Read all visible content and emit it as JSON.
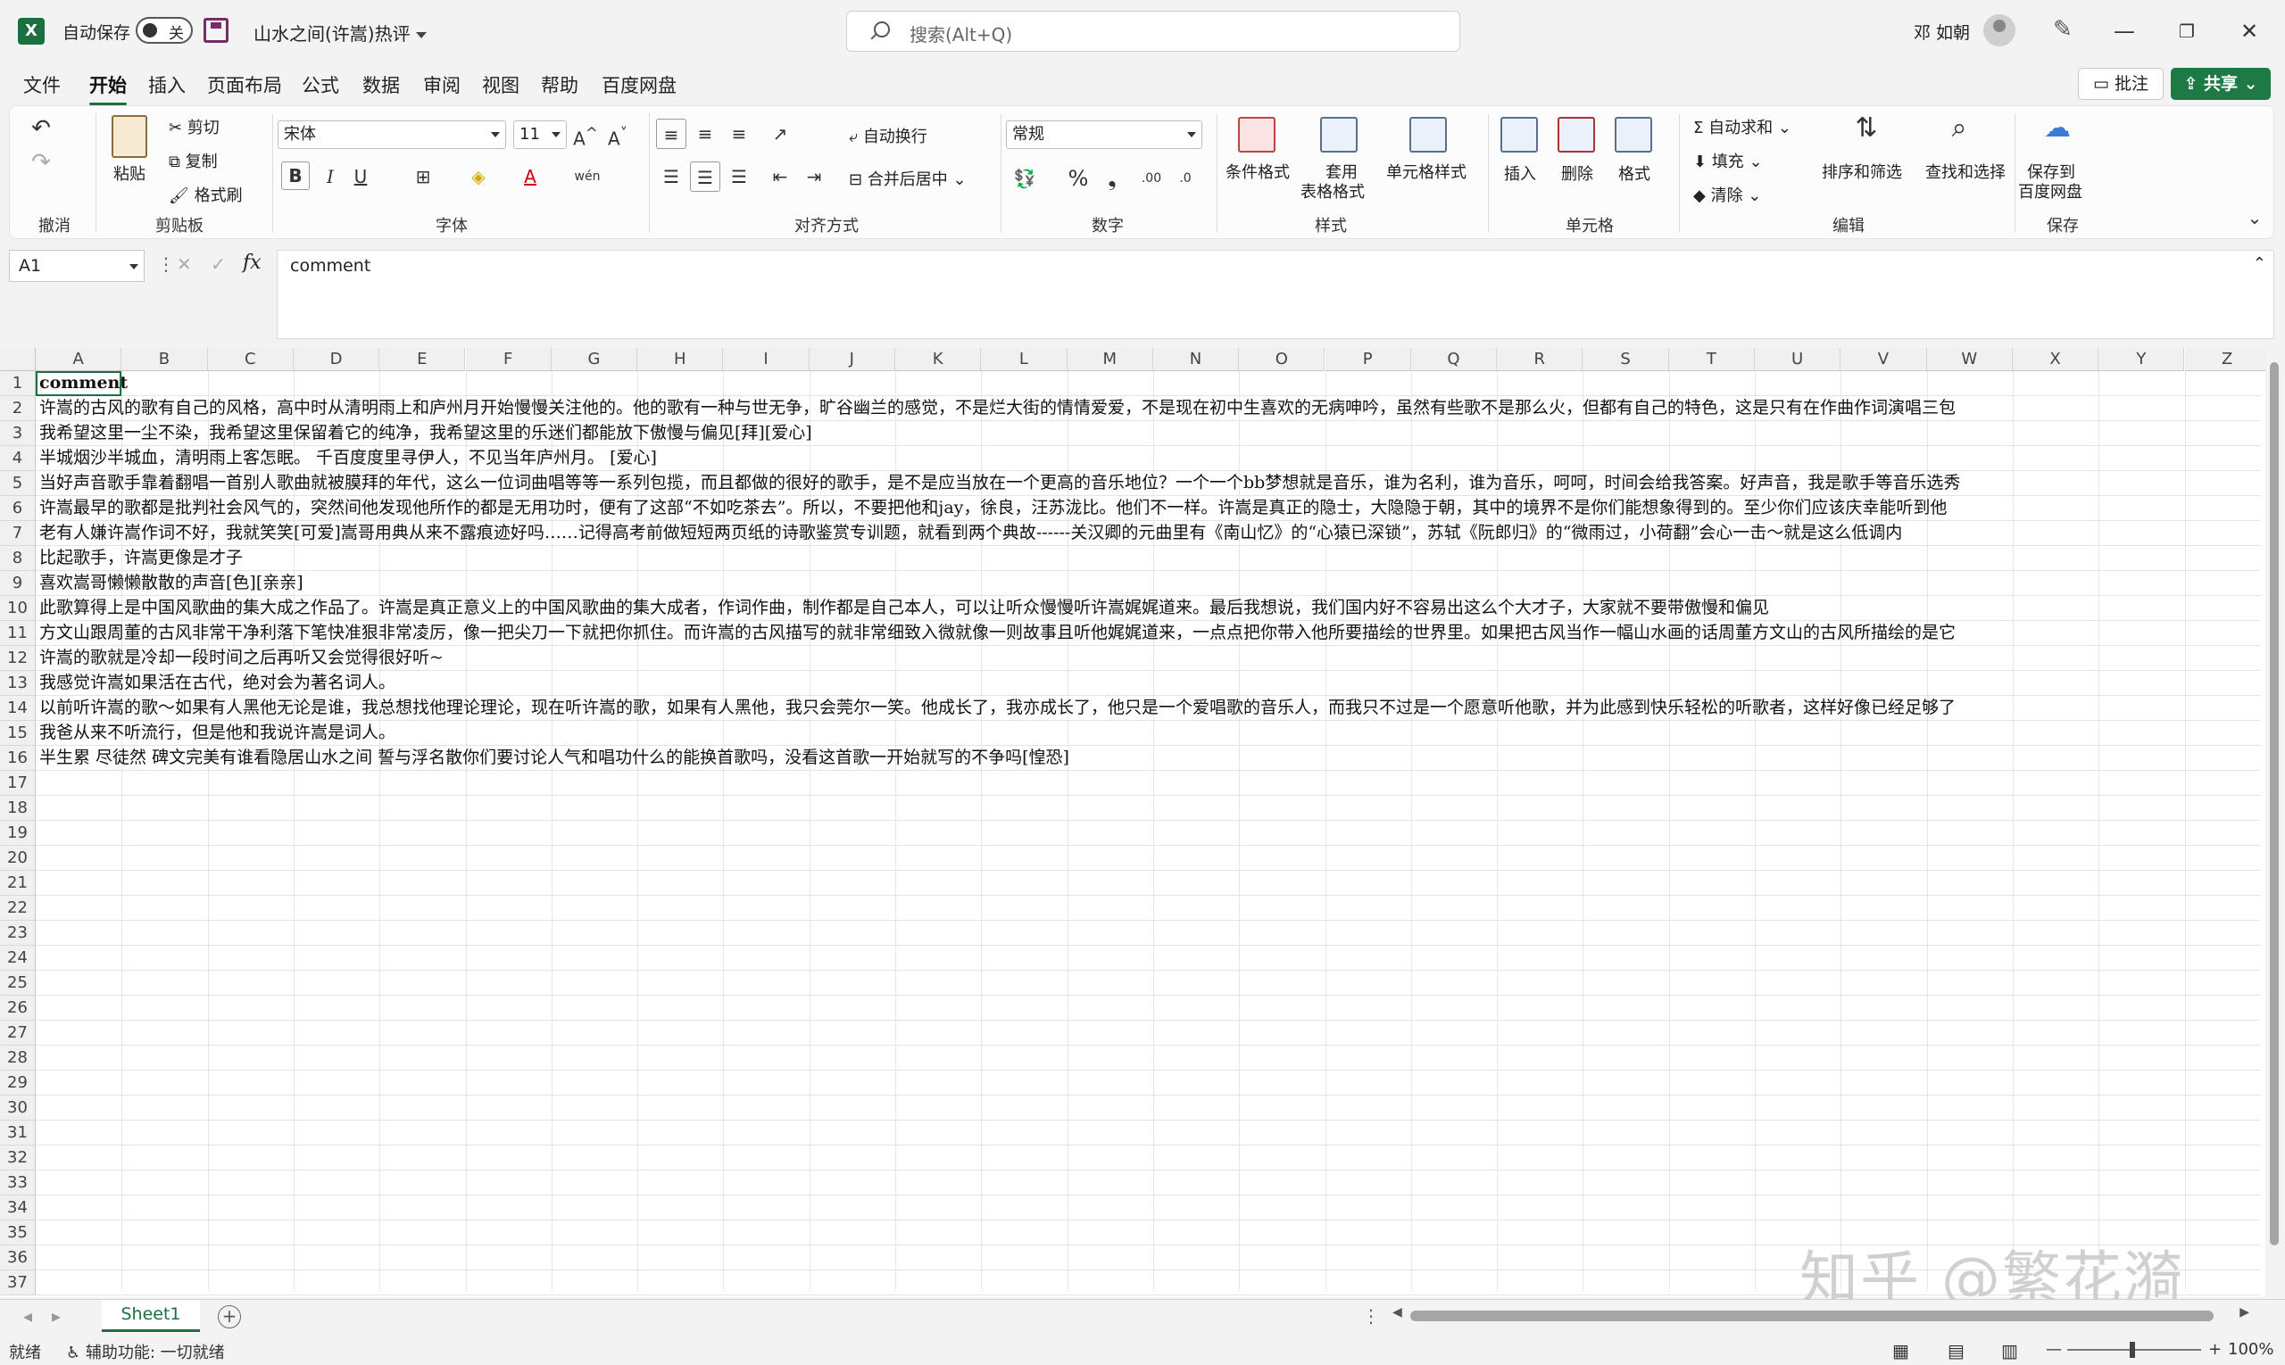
{
  "titlebar": {
    "autosave_label": "自动保存",
    "autosave_state": "关",
    "document_title": "山水之间(许嵩)热评",
    "search_placeholder": "搜索(Alt+Q)",
    "user_name": "邓 如朝"
  },
  "menu": {
    "tabs": [
      "文件",
      "开始",
      "插入",
      "页面布局",
      "公式",
      "数据",
      "审阅",
      "视图",
      "帮助",
      "百度网盘"
    ],
    "active_tab": "开始",
    "comment_label": "批注",
    "share_label": "共享"
  },
  "ribbon": {
    "groups": {
      "undo": "撤消",
      "clipboard": "剪贴板",
      "font": "字体",
      "alignment": "对齐方式",
      "number": "数字",
      "styles": "样式",
      "cells": "单元格",
      "editing": "编辑",
      "save": "保存"
    },
    "paste": "粘贴",
    "cut": "剪切",
    "copy": "复制",
    "format_painter": "格式刷",
    "font_name": "宋体",
    "font_size": "11",
    "wrap_text": "自动换行",
    "merge_center": "合并后居中",
    "number_format": "常规",
    "conditional_format": "条件格式",
    "table_format_1": "套用",
    "table_format_2": "表格格式",
    "cell_styles": "单元格样式",
    "insert": "插入",
    "delete": "删除",
    "format": "格式",
    "autosum": "自动求和",
    "fill": "填充",
    "clear": "清除",
    "sort_filter": "排序和筛选",
    "find_select": "查找和选择",
    "save_baidu_1": "保存到",
    "save_baidu_2": "百度网盘"
  },
  "formula_bar": {
    "cell_ref": "A1",
    "content": "comment"
  },
  "sheet": {
    "columns": [
      "A",
      "B",
      "C",
      "D",
      "E",
      "F",
      "G",
      "H",
      "I",
      "J",
      "K",
      "L",
      "M",
      "N",
      "O",
      "P",
      "Q",
      "R",
      "S",
      "T",
      "U",
      "V",
      "W",
      "X",
      "Y",
      "Z"
    ],
    "rows": [
      "comment",
      "许嵩的古风的歌有自己的风格，高中时从清明雨上和庐州月开始慢慢关注他的。他的歌有一种与世无争，旷谷幽兰的感觉，不是烂大街的情情爱爱，不是现在初中生喜欢的无病呻吟，虽然有些歌不是那么火，但都有自己的特色，这是只有在作曲作词演唱三包",
      "我希望这里一尘不染，我希望这里保留着它的纯净，我希望这里的乐迷们都能放下傲慢与偏见[拜][爱心]",
      "半城烟沙半城血，清明雨上客怎眠。  千百度度里寻伊人，不见当年庐州月。 [爱心]",
      "当好声音歌手靠着翻唱一首别人歌曲就被膜拜的年代，这么一位词曲唱等等一系列包揽，而且都做的很好的歌手，是不是应当放在一个更高的音乐地位？一个一个bb梦想就是音乐，谁为名利，谁为音乐，呵呵，时间会给我答案。好声音，我是歌手等音乐选秀",
      "许嵩最早的歌都是批判社会风气的，突然间他发现他所作的都是无用功时，便有了这部“不如吃茶去”。所以，不要把他和jay，徐良，汪苏泷比。他们不一样。许嵩是真正的隐士，大隐隐于朝，其中的境界不是你们能想象得到的。至少你们应该庆幸能听到他",
      "老有人嫌许嵩作词不好，我就笑笑[可爱]嵩哥用典从来不露痕迹好吗……记得高考前做短短两页纸的诗歌鉴赏专训题，就看到两个典故------关汉卿的元曲里有《南山忆》的“心猿已深锁”，苏轼《阮郎归》的“微雨过，小荷翻”会心一击～就是这么低调内",
      "比起歌手，许嵩更像是才子",
      "喜欢嵩哥懒懒散散的声音[色][亲亲]",
      "此歌算得上是中国风歌曲的集大成之作品了。许嵩是真正意义上的中国风歌曲的集大成者，作词作曲，制作都是自己本人，可以让听众慢慢听许嵩娓娓道来。最后我想说，我们国内好不容易出这么个大才子，大家就不要带傲慢和偏见",
      "方文山跟周董的古风非常干净利落下笔快准狠非常凌厉，像一把尖刀一下就把你抓住。而许嵩的古风描写的就非常细致入微就像一则故事且听他娓娓道来，一点点把你带入他所要描绘的世界里。如果把古风当作一幅山水画的话周董方文山的古风所描绘的是它",
      "许嵩的歌就是冷却一段时间之后再听又会觉得很好听~",
      "我感觉许嵩如果活在古代，绝对会为著名词人。",
      "以前听许嵩的歌～如果有人黑他无论是谁，我总想找他理论理论，现在听许嵩的歌，如果有人黑他，我只会莞尔一笑。他成长了，我亦成长了，他只是一个爱唱歌的音乐人，而我只不过是一个愿意听他歌，并为此感到快乐轻松的听歌者，这样好像已经足够了",
      "我爸从来不听流行，但是他和我说许嵩是词人。",
      "半生累 尽徒然 碑文完美有谁看隐居山水之间 誓与浮名散你们要讨论人气和唱功什么的能换首歌吗，没看这首歌一开始就写的不争吗[惶恐]",
      "",
      "",
      "",
      "",
      "",
      "",
      "",
      "",
      "",
      "",
      "",
      "",
      "",
      "",
      "",
      "",
      "",
      "",
      "",
      "",
      ""
    ]
  },
  "sheet_tabs": {
    "active": "Sheet1"
  },
  "status": {
    "ready": "就绪",
    "accessibility": "辅助功能: 一切就绪",
    "zoom": "100%"
  },
  "watermark": "知乎 @繁花漪",
  "colors": {
    "accent": "#1d6f42",
    "share": "#1d7a45"
  }
}
